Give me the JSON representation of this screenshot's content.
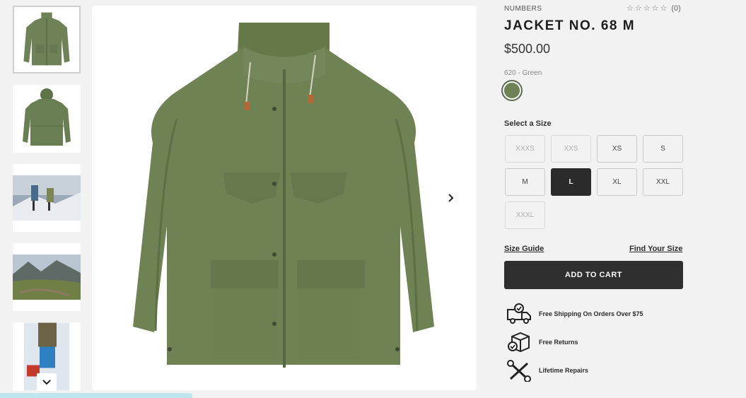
{
  "gallery": {
    "thumbnails": [
      {
        "name": "jacket-front"
      },
      {
        "name": "jacket-back"
      },
      {
        "name": "hikers-snow"
      },
      {
        "name": "mountain-landscape"
      },
      {
        "name": "person-snow"
      }
    ]
  },
  "product": {
    "brand": "NUMBERS",
    "rating_count": "(0)",
    "title": "JACKET NO. 68 M",
    "price": "$500.00",
    "color_label": "620 - Green",
    "color_hex": "#6f8257"
  },
  "size": {
    "label": "Select a Size",
    "options": [
      {
        "label": "XXXS",
        "state": "unavailable"
      },
      {
        "label": "XXS",
        "state": "unavailable"
      },
      {
        "label": "XS",
        "state": "available"
      },
      {
        "label": "S",
        "state": "available"
      },
      {
        "label": "M",
        "state": "available"
      },
      {
        "label": "L",
        "state": "selected"
      },
      {
        "label": "XL",
        "state": "available"
      },
      {
        "label": "XXL",
        "state": "available"
      },
      {
        "label": "XXXL",
        "state": "unavailable"
      }
    ]
  },
  "links": {
    "size_guide": "Size Guide",
    "find_size": "Find Your Size"
  },
  "cart": {
    "add_label": "ADD TO CART"
  },
  "benefits": [
    {
      "icon": "delivery-truck-icon",
      "text": "Free Shipping On Orders Over $75"
    },
    {
      "icon": "return-box-icon",
      "text": "Free Returns"
    },
    {
      "icon": "repair-tools-icon",
      "text": "Lifetime Repairs"
    }
  ],
  "colors": {
    "accent_dark": "#2f2f2f",
    "jacket_green": "#6f8257",
    "background": "#f2f2f2"
  }
}
